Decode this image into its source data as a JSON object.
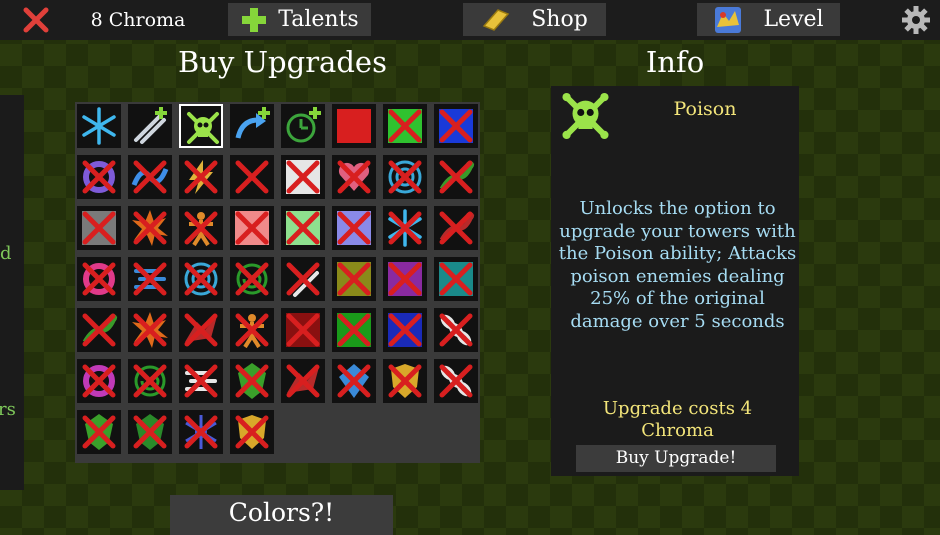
{
  "topbar": {
    "chroma": "8 Chroma",
    "talents_label": "Talents",
    "shop_label": "Shop",
    "level_label": "Level"
  },
  "left_panel": {
    "fragment_1": "d",
    "fragment_2": "rs"
  },
  "upgrades": {
    "heading": "Buy Upgrades",
    "colors_button": "Colors?!",
    "cells": [
      {
        "icon": "snowflake-icon",
        "color": "#3fb7ee",
        "locked": false
      },
      {
        "icon": "swords-plus-icon",
        "color": "#cfd6de",
        "locked": false
      },
      {
        "icon": "poison-skull-icon",
        "color": "#9be34a",
        "locked": false,
        "selected": true
      },
      {
        "icon": "arrow-plus-icon",
        "color": "#4aa3f0",
        "locked": false
      },
      {
        "icon": "clock-plus-icon",
        "color": "#3ca53c",
        "locked": false
      },
      {
        "icon": "red-square-icon",
        "color": "#d81f1f",
        "locked": true
      },
      {
        "icon": "green-square-icon",
        "color": "#2fc22f",
        "locked": true
      },
      {
        "icon": "blue-square-icon",
        "color": "#1a3ad8",
        "locked": true
      },
      {
        "icon": "ring-icon",
        "color": "#7e5bd8",
        "locked": true
      },
      {
        "icon": "wave-icon",
        "color": "#3e8ee8",
        "locked": true
      },
      {
        "icon": "bolt-icon",
        "color": "#e0b23a",
        "locked": true
      },
      {
        "icon": "black-square-icon",
        "color": "#111111",
        "locked": true
      },
      {
        "icon": "white-square-icon",
        "color": "#e6e6e6",
        "locked": true
      },
      {
        "icon": "heart-icon",
        "color": "#e06080",
        "locked": true
      },
      {
        "icon": "target-icon",
        "color": "#3aa8d8",
        "locked": true
      },
      {
        "icon": "lizard-icon",
        "color": "#3a9a2a",
        "locked": true
      },
      {
        "icon": "gray-square-icon",
        "color": "#7a7a7a",
        "locked": true
      },
      {
        "icon": "burst-icon",
        "color": "#e06a1a",
        "locked": true
      },
      {
        "icon": "figure-icon",
        "color": "#e08a2a",
        "locked": true
      },
      {
        "icon": "pink-square-icon",
        "color": "#f08a8a",
        "locked": true
      },
      {
        "icon": "lightgreen-square-icon",
        "color": "#8ee08e",
        "locked": true
      },
      {
        "icon": "lavender-square-icon",
        "color": "#8a8ae8",
        "locked": true
      },
      {
        "icon": "snowflake-icon",
        "color": "#3fb7ee",
        "locked": true
      },
      {
        "icon": "lizard-icon",
        "color": "#b82a2a",
        "locked": true
      },
      {
        "icon": "ring-icon",
        "color": "#e03a8a",
        "locked": true
      },
      {
        "icon": "dash-icon",
        "color": "#3a8ad8",
        "locked": true
      },
      {
        "icon": "target-icon",
        "color": "#3aa8d8",
        "locked": true
      },
      {
        "icon": "spiral-icon",
        "color": "#2a9a2a",
        "locked": true
      },
      {
        "icon": "swords-icon",
        "color": "#e6e6e6",
        "locked": true
      },
      {
        "icon": "olive-square-icon",
        "color": "#8a8a1a",
        "locked": true
      },
      {
        "icon": "purple-square-icon",
        "color": "#8a2aa0",
        "locked": true
      },
      {
        "icon": "teal-square-icon",
        "color": "#1a8a8a",
        "locked": true
      },
      {
        "icon": "lizard-icon",
        "color": "#3a9a2a",
        "locked": true
      },
      {
        "icon": "burst-icon",
        "color": "#e06a1a",
        "locked": true
      },
      {
        "icon": "dragon-icon",
        "color": "#b82a2a",
        "locked": true
      },
      {
        "icon": "figure-icon",
        "color": "#e08a2a",
        "locked": true
      },
      {
        "icon": "darkred-square-icon",
        "color": "#8a1010",
        "locked": true
      },
      {
        "icon": "redgreen-square-icon",
        "color": "#1a9a1a",
        "locked": true
      },
      {
        "icon": "redblue-square-icon",
        "color": "#1a2ab8",
        "locked": true
      },
      {
        "icon": "chain-icon",
        "color": "#e6e6e6",
        "locked": true
      },
      {
        "icon": "ring-icon",
        "color": "#c03ab8",
        "locked": true
      },
      {
        "icon": "spiral-icon",
        "color": "#2a9a2a",
        "locked": true
      },
      {
        "icon": "dash-icon",
        "color": "#e6e6e6",
        "locked": true
      },
      {
        "icon": "leaf-icon",
        "color": "#3aa02a",
        "locked": true
      },
      {
        "icon": "dragon-icon",
        "color": "#b82a2a",
        "locked": true
      },
      {
        "icon": "gem-icon",
        "color": "#3a8ad8",
        "locked": true
      },
      {
        "icon": "shield-icon",
        "color": "#d8a82a",
        "locked": true
      },
      {
        "icon": "chain-icon",
        "color": "#e6e6e6",
        "locked": true
      },
      {
        "icon": "leaf-icon",
        "color": "#3aa02a",
        "locked": true
      },
      {
        "icon": "leaf-icon",
        "color": "#2a8a2a",
        "locked": true
      },
      {
        "icon": "crystal-icon",
        "color": "#4a5ad8",
        "locked": true
      },
      {
        "icon": "shield-icon",
        "color": "#d8a82a",
        "locked": true
      }
    ]
  },
  "info": {
    "heading": "Info",
    "title": "Poison",
    "icon": "poison-skull-icon",
    "description": "Unlocks the option to upgrade your towers with the Poison ability; Attacks poison enemies dealing 25% of the original damage over 5 seconds",
    "cost": "Upgrade costs 4 Chroma",
    "buy_button": "Buy Upgrade!"
  },
  "colors": {
    "lock_x": "#d81f1f",
    "info_title": "#f3e57a",
    "info_text": "#a6dcf3",
    "left_text": "#7ec85a"
  }
}
